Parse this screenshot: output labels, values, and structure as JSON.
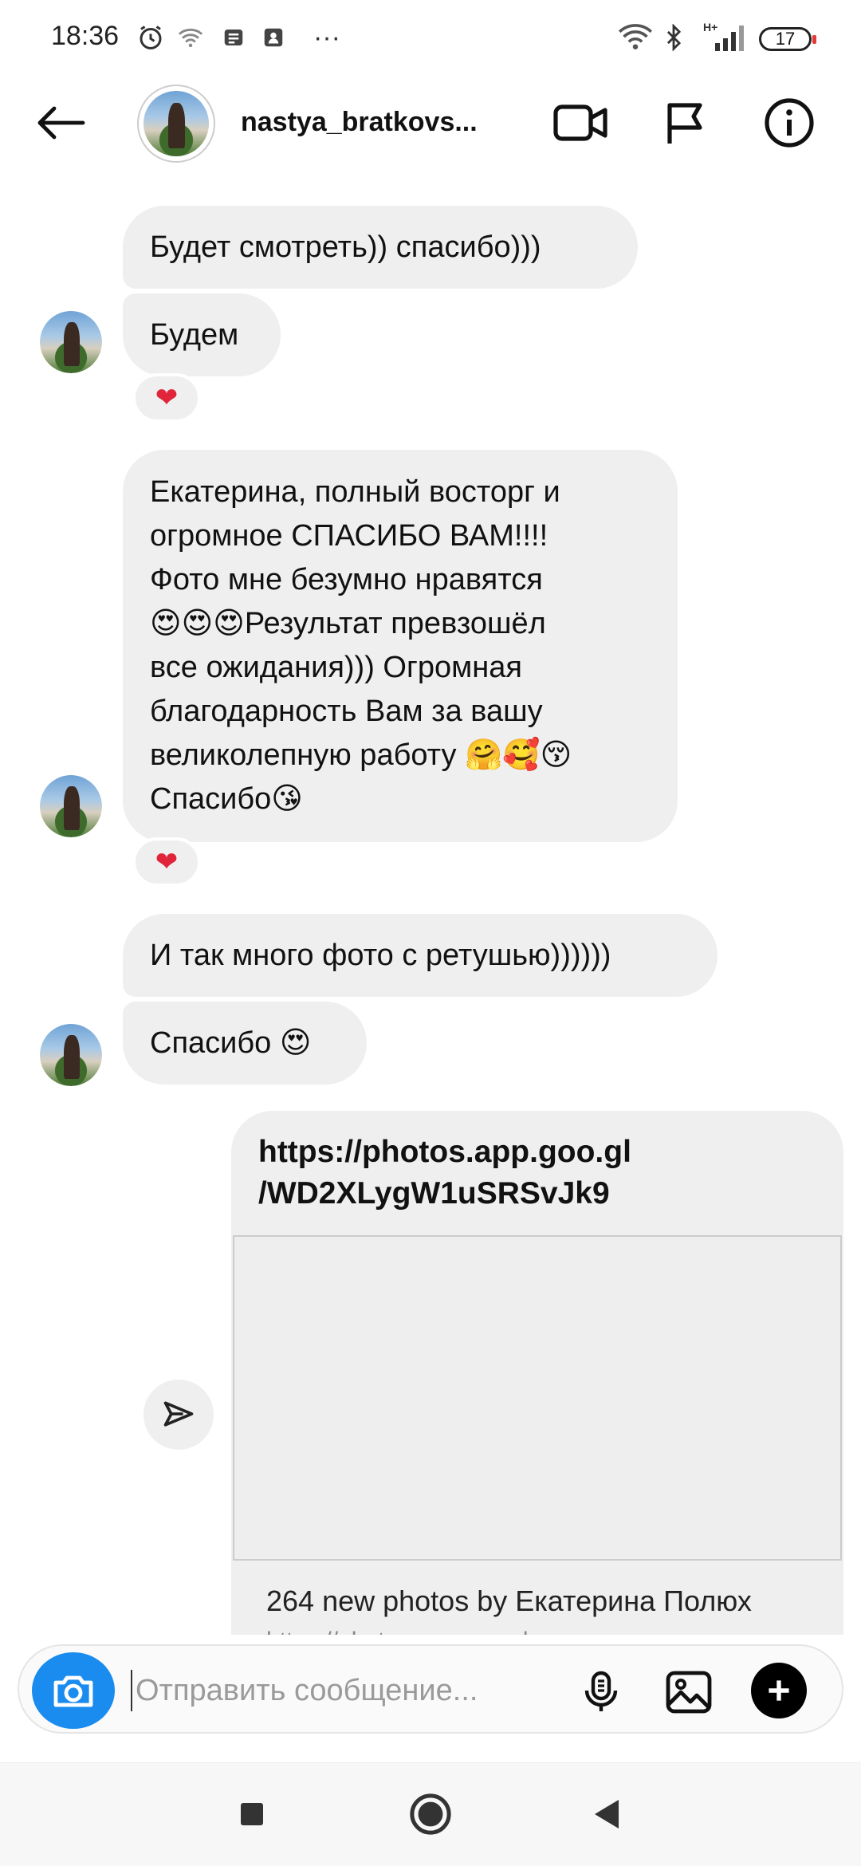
{
  "status_bar": {
    "time": "18:36",
    "more": "···",
    "network": "H+",
    "battery": "17"
  },
  "header": {
    "username": "nastya_bratkovs..."
  },
  "messages": [
    {
      "id": "m1",
      "text": "Будет смотреть)) спасибо)))"
    },
    {
      "id": "m2",
      "text": "Будем",
      "reaction": "❤"
    },
    {
      "id": "m3",
      "lines": [
        "Екатерина, полный восторг и",
        "огромное СПАСИБО ВАМ!!!!",
        "Фото мне безумно нравятся",
        "😍😍😍Результат превзошёл",
        "все ожидания))) Огромная",
        "благодарность Вам за вашу",
        "великолепную работу 🤗🥰😚",
        "Спасибо😘"
      ],
      "reaction": "❤"
    },
    {
      "id": "m4",
      "text": "И так много фото с ретушью))))))"
    },
    {
      "id": "m5",
      "text": "Спасибо 😍"
    }
  ],
  "link_message": {
    "url_line1": "https://photos.app.goo.gl",
    "url_line2": "/WD2XLygW1uSRSvJk9",
    "preview_title": "264 new photos by Екатерина Полюх",
    "preview_subtitle": "https://photos.app.goo.gl"
  },
  "composer": {
    "placeholder": "Отправить сообщение..."
  },
  "colors": {
    "bubble": "#efefef",
    "camera_button": "#1a8cf0",
    "heart": "#e0243a"
  }
}
